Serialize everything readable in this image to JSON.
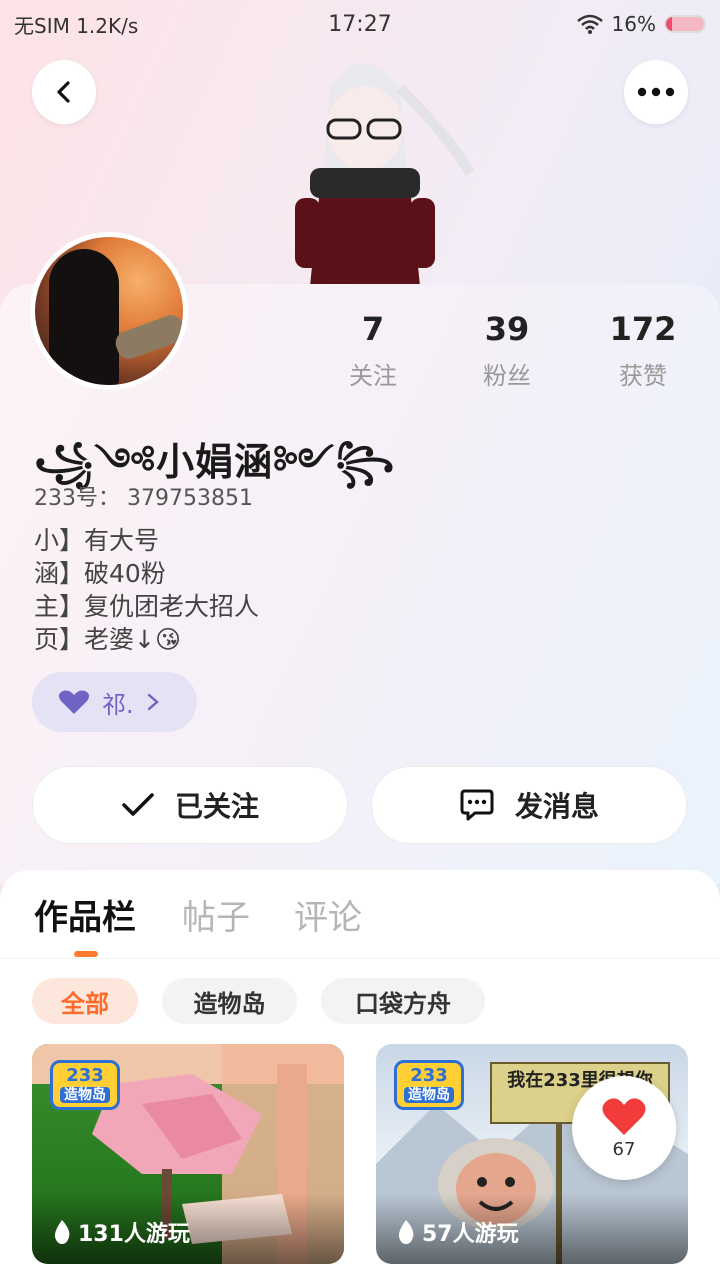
{
  "status_bar": {
    "left": "无SIM 1.2K/s",
    "time": "17:27",
    "battery": "16%"
  },
  "profile": {
    "stats": [
      {
        "value": "7",
        "label": "关注"
      },
      {
        "value": "39",
        "label": "粉丝"
      },
      {
        "value": "172",
        "label": "获赞"
      }
    ],
    "nickname": "꧁༺小娟涵༻꧂",
    "uid": "233号： 379753851",
    "bio": [
      "小】有大号",
      "涵】破40粉",
      "主】复仇团老大招人",
      "页】老婆↓😘"
    ],
    "tag_label": "祁.",
    "tag_color": "#6f63c4",
    "follow_label": "已关注",
    "message_label": "发消息"
  },
  "tabs": [
    "作品栏",
    "帖子",
    "评论"
  ],
  "filter_chips": [
    "全部",
    "造物岛",
    "口袋方舟"
  ],
  "accent_color": "#ff6a2a",
  "cards": [
    {
      "logo_top": "233",
      "logo_bottom": "造物岛",
      "plays": "131人游玩"
    },
    {
      "logo_top": "233",
      "logo_bottom": "造物岛",
      "plays": "57人游玩",
      "sign_text": "我在233里很想你"
    }
  ],
  "like": {
    "count": "67"
  }
}
